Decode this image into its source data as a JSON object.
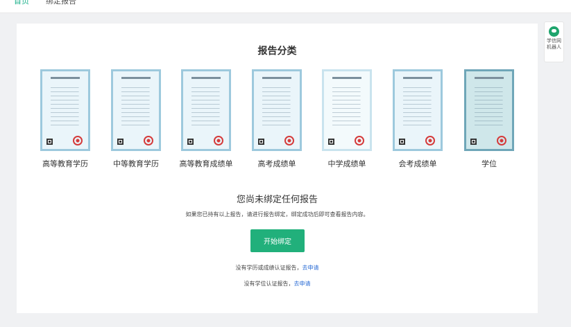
{
  "nav": {
    "tabs": [
      "首页",
      "绑定报告"
    ]
  },
  "main": {
    "title": "报告分类",
    "reports": [
      {
        "label": "高等教育学历"
      },
      {
        "label": "中等教育学历"
      },
      {
        "label": "高等教育成绩单"
      },
      {
        "label": "高考成绩单"
      },
      {
        "label": "中学成绩单"
      },
      {
        "label": "会考成绩单"
      },
      {
        "label": "学位"
      }
    ],
    "empty_title": "您尚未绑定任何报告",
    "empty_desc": "如果您已持有以上报告，请进行报告绑定，绑定成功后即可查看报告内容。",
    "start_button": "开始绑定",
    "apply_line1_text": "没有学历或成绩认证报告，",
    "apply_line2_text": "没有学位认证报告，",
    "apply_link": "去申请"
  },
  "robot": {
    "line1": "学信网",
    "line2": "机器人"
  },
  "colors": {
    "accent": "#21b07b",
    "link": "#2f6fd6",
    "background": "#f0f1f3"
  },
  "icons": {
    "robot": "robot-avatar-icon",
    "seal": "red-seal-icon",
    "qr": "qr-code-icon"
  }
}
